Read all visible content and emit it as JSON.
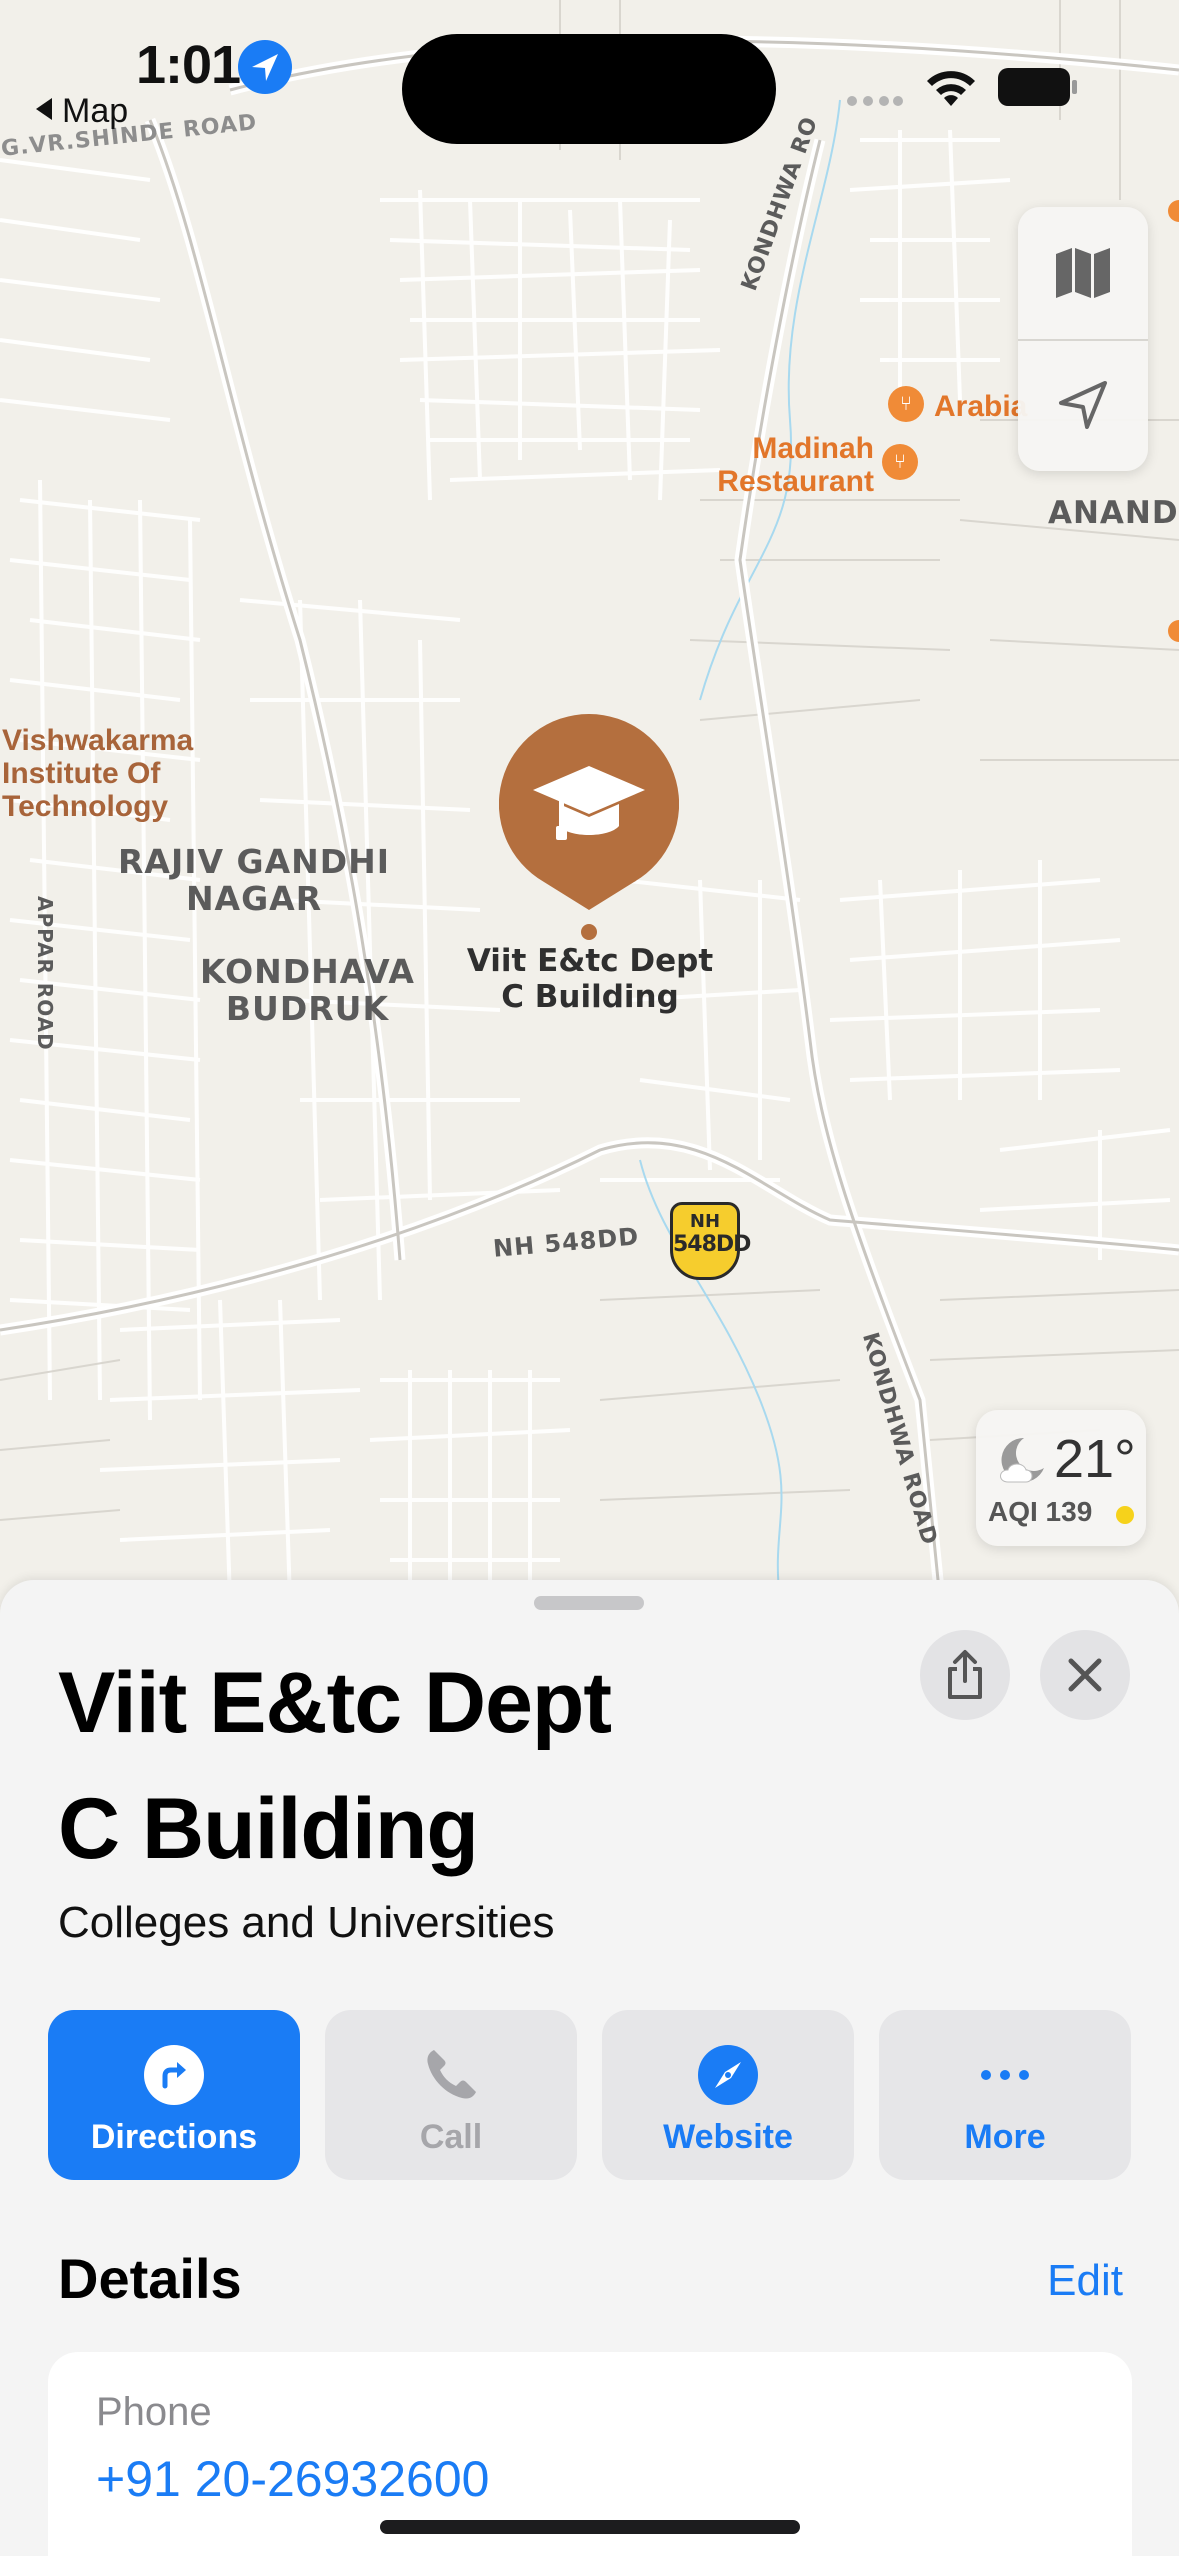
{
  "status_bar": {
    "time": "1:01",
    "back_label": "Map"
  },
  "map": {
    "labels": {
      "rajiv_gandhi_nagar": "RAJIV GANDHI\nNAGAR",
      "kondhava_budruk": "KONDHAVA\nBUDRUK",
      "anandp": "ANANDP",
      "nh_548dd": "NH 548DD",
      "kondhwa_road_top": "KONDHWA RO",
      "kondhwa_road_bottom": "KONDHWA ROAD",
      "appar_road": "APPAR ROAD",
      "vr_shinde_road": "G.VR.SHINDE ROAD",
      "vishwakarma": "Vishwakarma\nInstitute Of\nTechnology",
      "madinah": "Madinah\nRestaurant",
      "arabia": "Arabia",
      "highway_shield_top": "NH",
      "highway_shield_bottom": "548DD"
    },
    "pin": {
      "label": "Viit E&tc Dept\nC Building",
      "icon": "graduation-cap-icon",
      "color": "#b46f3e"
    },
    "controls": {
      "icons": [
        "map-mode-icon",
        "location-arrow-icon"
      ]
    }
  },
  "weather": {
    "temperature": "21°",
    "aqi": "AQI 139",
    "icon": "moon-cloud-icon"
  },
  "sheet": {
    "title": "Viit E&tc Dept\nC Building",
    "category": "Colleges and Universities",
    "actions": [
      {
        "label": "Directions",
        "icon": "directions-icon"
      },
      {
        "label": "Call",
        "icon": "phone-icon"
      },
      {
        "label": "Website",
        "icon": "compass-icon"
      },
      {
        "label": "More",
        "icon": "ellipsis-icon"
      }
    ],
    "details": {
      "heading": "Details",
      "edit": "Edit",
      "phone_label": "Phone",
      "phone_number": "+91 20-26932600"
    }
  },
  "colors": {
    "accent": "#1a7cf5",
    "pin": "#b46f3e",
    "map_bg": "#f2f0ea"
  }
}
